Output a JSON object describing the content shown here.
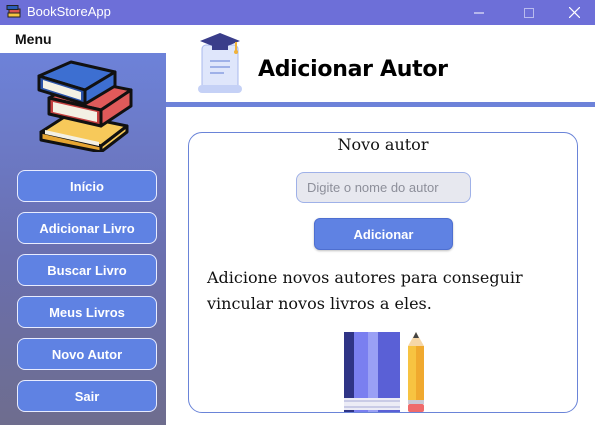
{
  "window": {
    "title": "BookStoreApp",
    "icon": "books-app-icon",
    "controls": [
      "minimize-icon",
      "maximize-icon",
      "close-icon"
    ]
  },
  "sidebar": {
    "title": "Menu",
    "logo": "books-stack-icon",
    "items": [
      {
        "label": "Início"
      },
      {
        "label": "Adicionar Livro"
      },
      {
        "label": "Buscar Livro"
      },
      {
        "label": "Meus Livros"
      },
      {
        "label": "Novo Autor"
      },
      {
        "label": "Sair"
      }
    ]
  },
  "header": {
    "icon": "diploma-scroll-icon",
    "title": "Adicionar Autor"
  },
  "form": {
    "title": "Novo autor",
    "author_placeholder": "Digite o nome do autor",
    "author_value": "",
    "submit_label": "Adicionar",
    "description": "Adicione novos autores para conseguir vincular novos livros a eles.",
    "illustration": "book-and-pencil-icon"
  },
  "colors": {
    "titlebar": "#6d6fd8",
    "accent": "#5f82e3",
    "sidebar_top": "#6d82d9",
    "sidebar_bottom": "#6e6d8e",
    "card_border": "#6a84d8"
  }
}
